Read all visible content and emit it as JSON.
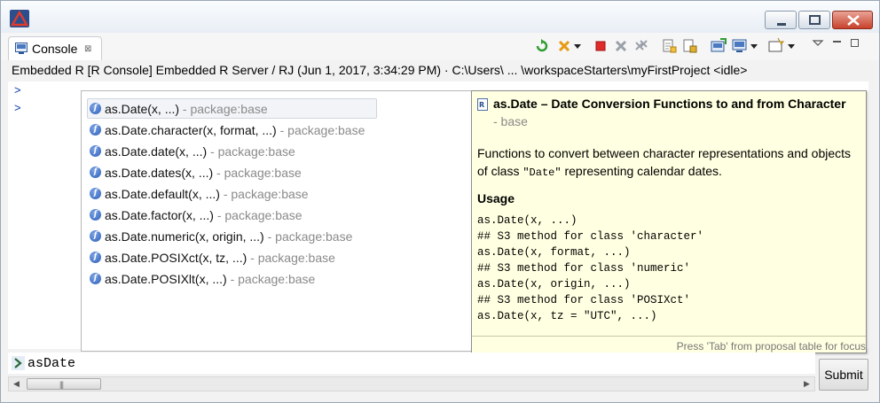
{
  "tabs": [
    {
      "label": "Console",
      "close": "⊠"
    }
  ],
  "console": {
    "header": "Embedded R [R Console] Embedded R Server / RJ (Jun 1, 2017, 3:34:29 PM)  ·  C:\\Users\\ ... \\workspaceStarters\\myFirstProject      <idle>",
    "prompts": [
      ">",
      ">"
    ],
    "input_value": "asDate",
    "submit_label": "Submit"
  },
  "proposals": [
    {
      "name": "as.Date(x, ...)",
      "pkg": " - package:base"
    },
    {
      "name": "as.Date.character(x, format, ...)",
      "pkg": " - package:base"
    },
    {
      "name": "as.Date.date(x, ...)",
      "pkg": " - package:base"
    },
    {
      "name": "as.Date.dates(x, ...)",
      "pkg": " - package:base"
    },
    {
      "name": "as.Date.default(x, ...)",
      "pkg": " - package:base"
    },
    {
      "name": "as.Date.factor(x, ...)",
      "pkg": " - package:base"
    },
    {
      "name": "as.Date.numeric(x, origin, ...)",
      "pkg": " - package:base"
    },
    {
      "name": "as.Date.POSIXct(x, tz, ...)",
      "pkg": " - package:base"
    },
    {
      "name": "as.Date.POSIXlt(x, ...)",
      "pkg": " - package:base"
    }
  ],
  "selected_proposal": 0,
  "doc": {
    "title": "as.Date – Date Conversion Functions to and from Character",
    "pkg": "- base",
    "desc_before": "Functions to convert between character representations and objects of class ",
    "desc_code": "\"Date\"",
    "desc_after": " representing calendar dates.",
    "usage_heading": "Usage",
    "usage": [
      "as.Date(x, ...)",
      "## S3 method for class 'character'",
      "as.Date(x, format, ...)",
      "## S3 method for class 'numeric'",
      "as.Date(x, origin, ...)",
      "## S3 method for class 'POSIXct'",
      "as.Date(x, tz = \"UTC\", ...)"
    ],
    "hint": "Press 'Tab' from proposal table for focus"
  },
  "colors": {
    "doc_bg": "#ffffe1",
    "prompt": "#0b3ea8",
    "package_text": "#8a8a8a"
  }
}
